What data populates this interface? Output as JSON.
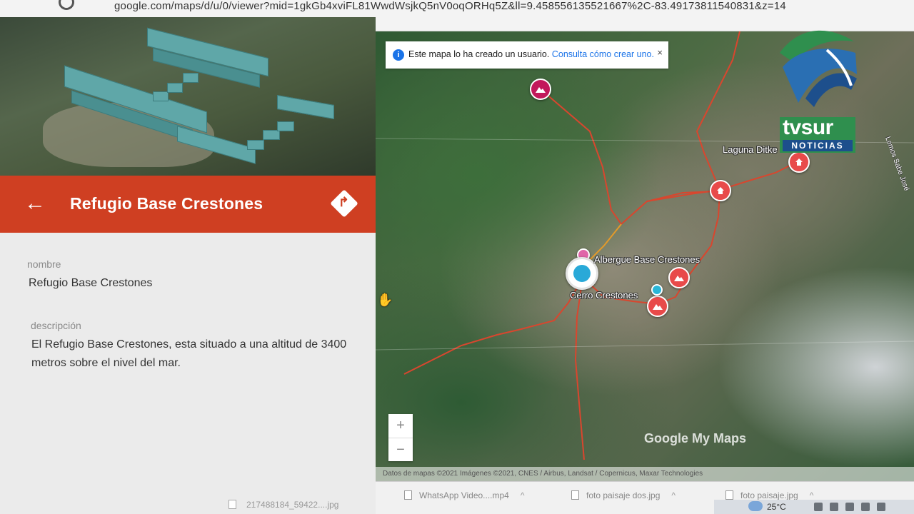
{
  "browser": {
    "url": "google.com/maps/d/u/0/viewer?mid=1gkGb4xviFL81WwdWsjkQ5nV0oqORHq5Z&ll=9.458556135521667%2C-83.49173811540831&z=14"
  },
  "place_panel": {
    "title": "Refugio Base Crestones",
    "fields": [
      {
        "label": "nombre",
        "value": "Refugio Base Crestones"
      },
      {
        "label": "descripción",
        "value": "El Refugio Base Crestones, esta situado a una altitud de 3400 metros sobre el nivel del mar."
      }
    ]
  },
  "map": {
    "notice": {
      "text": "Este mapa lo ha creado un usuario.",
      "link": "Consulta cómo crear uno.",
      "close": "×"
    },
    "labels": {
      "laguna": "Laguna Ditke",
      "albergue": "Albergue Base Crestones",
      "cerro": "Cerro Crestones",
      "road": "Lomos Sabe José"
    },
    "zoom": {
      "in": "+",
      "out": "−"
    },
    "brand": "Google My Maps",
    "attribution": "Datos de mapas ©2021 Imágenes ©2021, CNES / Airbus, Landsat / Copernicus, Maxar Technologies"
  },
  "downloads": [
    {
      "name": "217488184_59422....jpg"
    },
    {
      "name": "WhatsApp Video....mp4"
    },
    {
      "name": "foto paisaje dos.jpg"
    },
    {
      "name": "foto paisaje.jpg"
    }
  ],
  "taskbar": {
    "temperature": "25°C"
  },
  "broadcaster": {
    "name": "tvsur",
    "tag": "NOTICIAS"
  },
  "colors": {
    "header": "#cf3f22",
    "trail": "#d9462e",
    "marker_red": "#e84a4a",
    "marker_magenta": "#c2185b",
    "link": "#1a73e8"
  }
}
